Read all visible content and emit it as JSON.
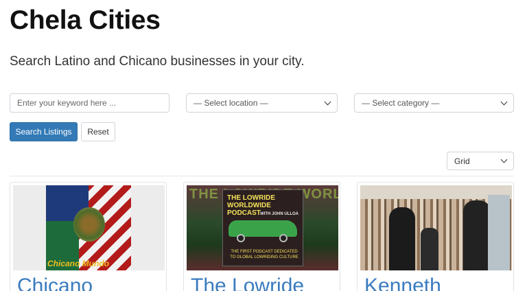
{
  "header": {
    "title": "Chela Cities",
    "subtitle": "Search Latino and Chicano businesses in your city."
  },
  "search": {
    "keyword_placeholder": "Enter your keyword here ...",
    "location_selected": "— Select location —",
    "category_selected": "— Select category —",
    "search_button": "Search Listings",
    "reset_button": "Reset"
  },
  "view": {
    "selected": "Grid"
  },
  "listings": [
    {
      "title": "Chicano",
      "image_text": "Chicano Mundo"
    },
    {
      "title": "The Lowride",
      "image_text": "THE LOWRIDE WORLDWIDE PODCAST",
      "image_bg_text": "THE LOWRIDE WORLDWIDE",
      "image_host": "WITH JOHN ULLOA",
      "image_caption": "THE FIRST PODCAST DEDICATED TO GLOBAL LOWRIDING CULTURE"
    },
    {
      "title": "Kenneth"
    }
  ],
  "colors": {
    "primary": "#337ab7",
    "link": "#3a7bbf"
  }
}
